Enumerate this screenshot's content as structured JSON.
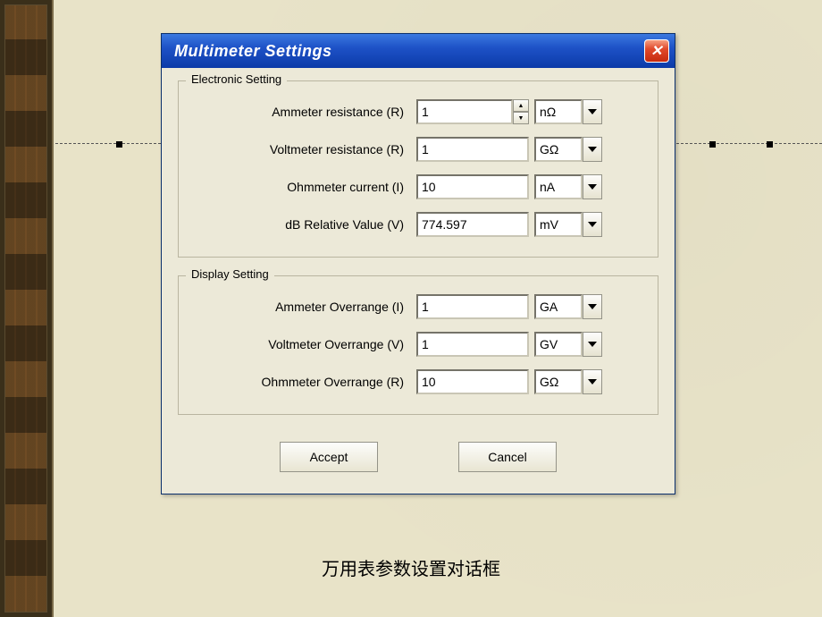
{
  "dialog": {
    "title": "Multimeter Settings",
    "groups": {
      "electronic": {
        "title": "Electronic Setting",
        "rows": {
          "ammeter_r": {
            "label": "Ammeter resistance (R)",
            "value": "1",
            "unit": "nΩ"
          },
          "voltmeter_r": {
            "label": "Voltmeter resistance (R)",
            "value": "1",
            "unit": "GΩ"
          },
          "ohmmeter_i": {
            "label": "Ohmmeter current (I)",
            "value": "10",
            "unit": "nA"
          },
          "db_rel": {
            "label": "dB Relative Value (V)",
            "value": "774.597",
            "unit": "mV"
          }
        }
      },
      "display": {
        "title": "Display Setting",
        "rows": {
          "ammeter_ov": {
            "label": "Ammeter Overrange (I)",
            "value": "1",
            "unit": "GA"
          },
          "voltmeter_ov": {
            "label": "Voltmeter Overrange (V)",
            "value": "1",
            "unit": "GV"
          },
          "ohmmeter_ov": {
            "label": "Ohmmeter Overrange (R)",
            "value": "10",
            "unit": "GΩ"
          }
        }
      }
    },
    "buttons": {
      "accept": "Accept",
      "cancel": "Cancel"
    }
  },
  "caption": "万用表参数设置对话框"
}
